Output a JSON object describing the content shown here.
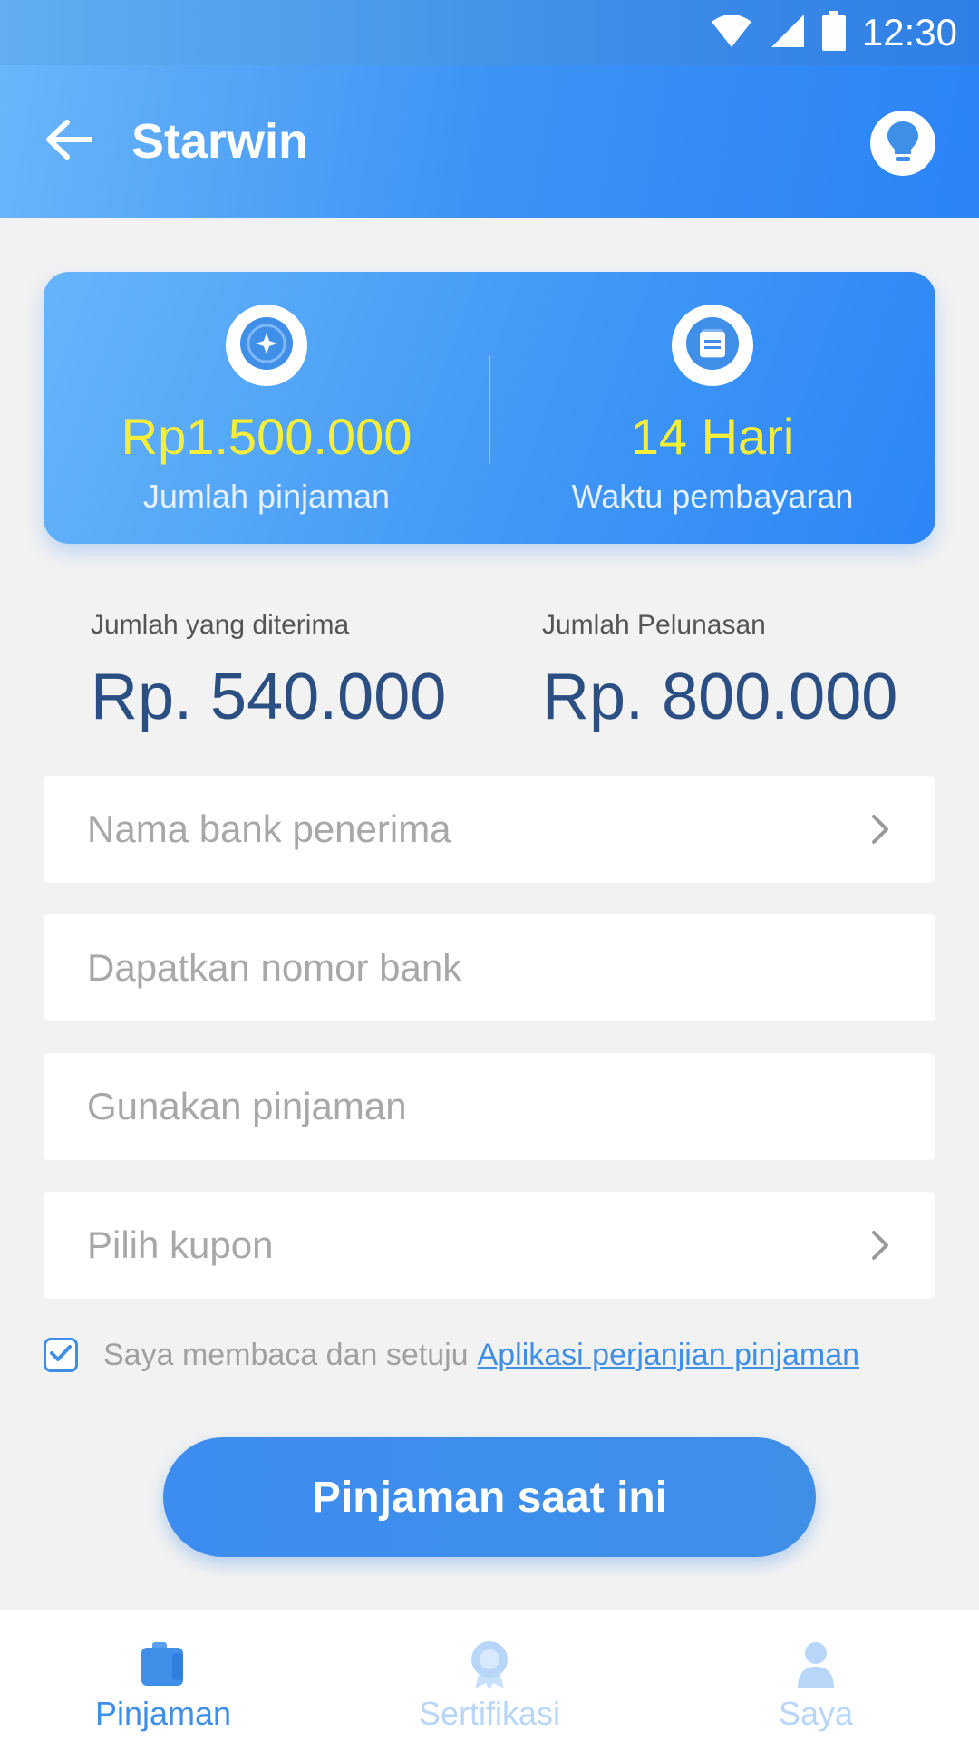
{
  "status_bar": {
    "time": "12:30",
    "icons": [
      "wifi-icon",
      "signal-icon",
      "battery-icon"
    ]
  },
  "app_bar": {
    "title": "Starwin",
    "back_icon": "arrow-left-icon",
    "action_icon": "lightbulb-icon"
  },
  "loan_card": {
    "amount": {
      "value": "Rp1.500.000",
      "label": "Jumlah pinjaman",
      "icon": "compass-star-icon"
    },
    "term": {
      "value": "14 Hari",
      "label": "Waktu pembayaran",
      "icon": "document-icon"
    }
  },
  "summary": {
    "received": {
      "label": "Jumlah yang diterima",
      "value": "Rp. 540.000"
    },
    "repayment": {
      "label": "Jumlah Pelunasan",
      "value": "Rp. 800.000"
    }
  },
  "form": {
    "bank_name": {
      "placeholder": "Nama bank penerima"
    },
    "bank_number": {
      "placeholder": "Dapatkan nomor bank"
    },
    "loan_use": {
      "placeholder": "Gunakan pinjaman"
    },
    "coupon": {
      "placeholder": "Pilih kupon"
    }
  },
  "agreement": {
    "checked": true,
    "text": "Saya membaca dan setuju",
    "link": "Aplikasi perjanjian pinjaman"
  },
  "cta": {
    "label": "Pinjaman saat ini"
  },
  "bottom_nav": [
    {
      "label": "Pinjaman",
      "icon": "wallet-icon",
      "active": true
    },
    {
      "label": "Sertifikasi",
      "icon": "badge-icon",
      "active": false
    },
    {
      "label": "Saya",
      "icon": "person-icon",
      "active": false
    }
  ],
  "colors": {
    "primary": "#3f8ee8",
    "value_yellow": "#f7ee3a",
    "summary_value": "#2b4f82",
    "inactive_nav": "#b8d6f7"
  }
}
